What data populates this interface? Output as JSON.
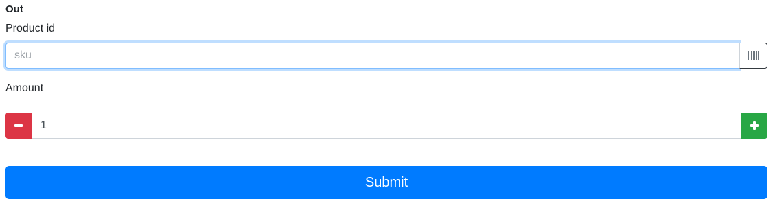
{
  "form": {
    "title": "Out",
    "product": {
      "label": "Product id",
      "placeholder": "sku",
      "value": "",
      "scan_icon": "barcode-icon"
    },
    "amount": {
      "label": "Amount",
      "value": "1",
      "decrement_icon": "minus-icon",
      "increment_icon": "plus-icon"
    },
    "submit_label": "Submit"
  },
  "colors": {
    "primary": "#007bff",
    "danger": "#dc3545",
    "success": "#28a745",
    "focus_border": "#80bdff"
  }
}
